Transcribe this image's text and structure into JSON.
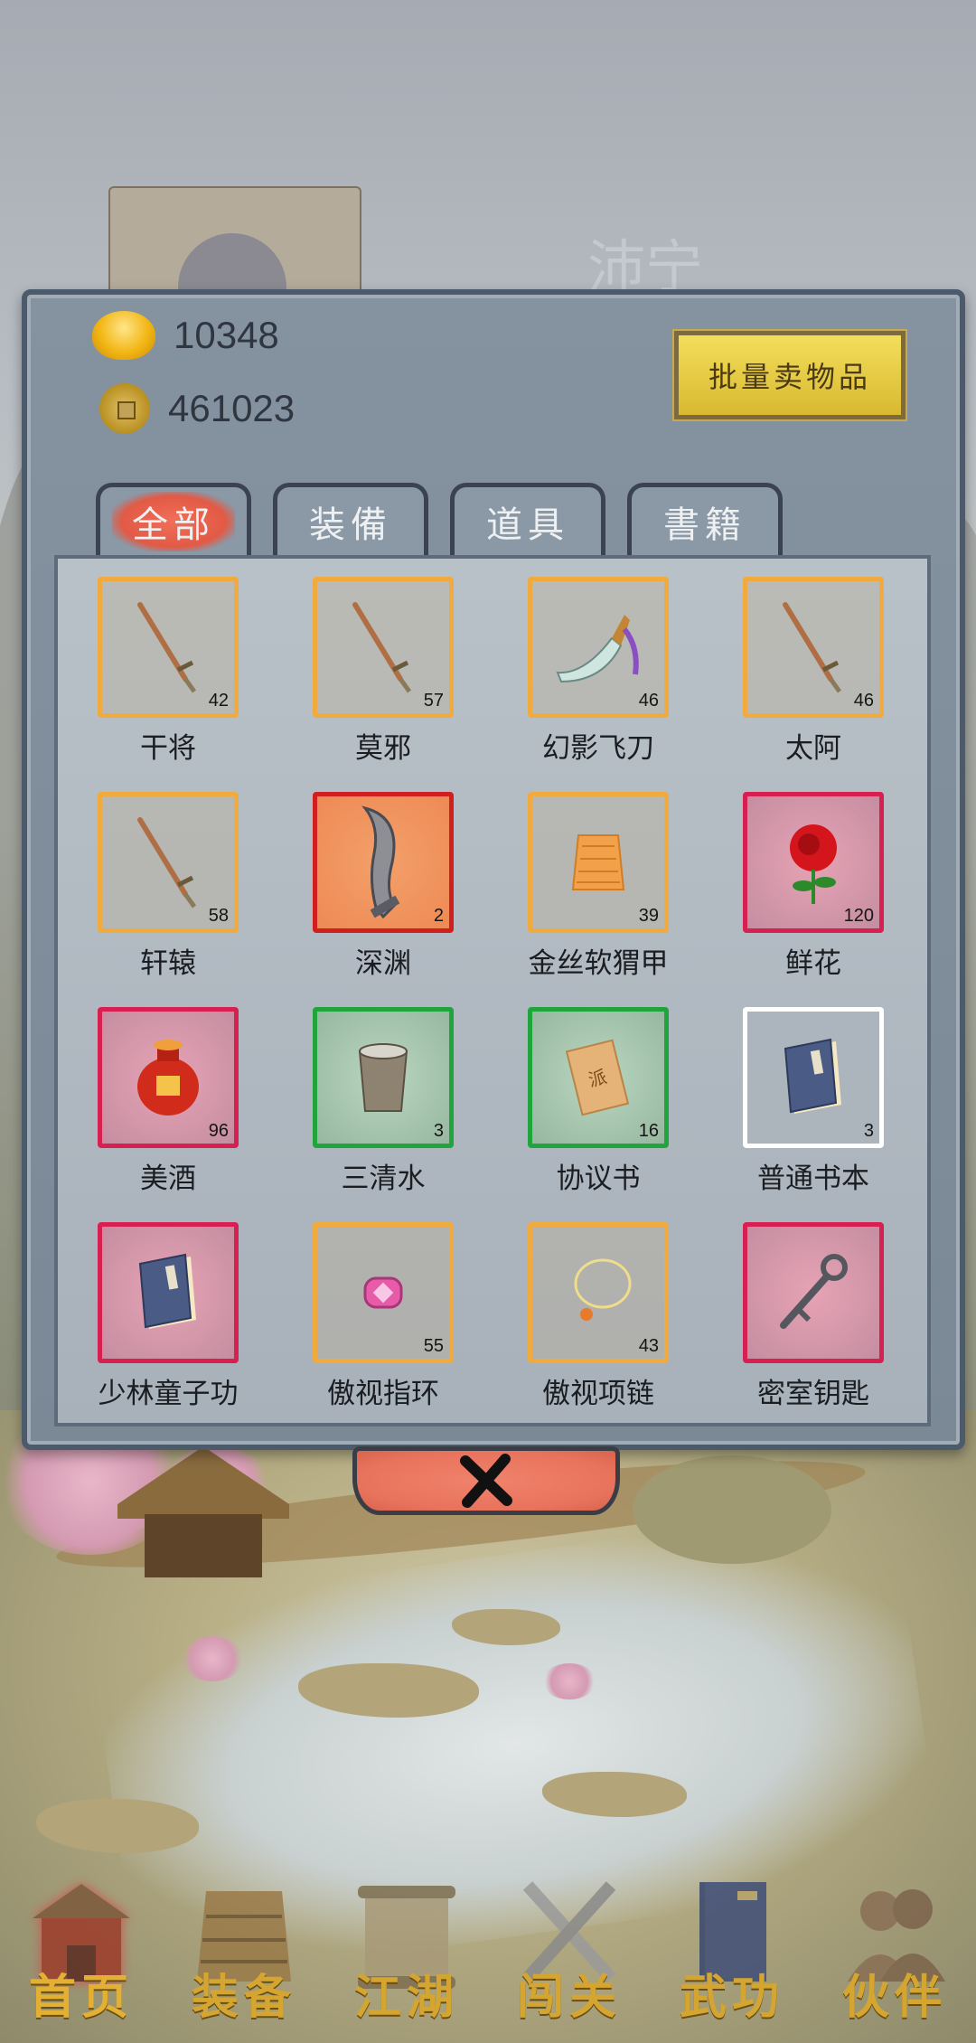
{
  "background": {
    "location_title": "沛宁"
  },
  "currency": {
    "gold": "10348",
    "coins": "461023"
  },
  "batch_sell_label": "批量卖物品",
  "tabs": [
    {
      "label": "全部",
      "active": true
    },
    {
      "label": "装備",
      "active": false
    },
    {
      "label": "道具",
      "active": false
    },
    {
      "label": "書籍",
      "active": false
    }
  ],
  "items": [
    {
      "name": "干将",
      "count": "42",
      "quality": "orange",
      "icon": "sword-icon"
    },
    {
      "name": "莫邪",
      "count": "57",
      "quality": "orange",
      "icon": "sword-icon"
    },
    {
      "name": "幻影飞刀",
      "count": "46",
      "quality": "orange",
      "icon": "flying-knife-icon"
    },
    {
      "name": "太阿",
      "count": "46",
      "quality": "orange",
      "icon": "sword-icon"
    },
    {
      "name": "轩辕",
      "count": "58",
      "quality": "orange",
      "icon": "sword-icon"
    },
    {
      "name": "深渊",
      "count": "2",
      "quality": "special",
      "icon": "abyss-blade-icon"
    },
    {
      "name": "金丝软猬甲",
      "count": "39",
      "quality": "orange",
      "icon": "armor-icon"
    },
    {
      "name": "鲜花",
      "count": "120",
      "quality": "red",
      "icon": "rose-icon"
    },
    {
      "name": "美酒",
      "count": "96",
      "quality": "red",
      "icon": "wine-jar-icon"
    },
    {
      "name": "三清水",
      "count": "3",
      "quality": "green",
      "icon": "bucket-icon"
    },
    {
      "name": "协议书",
      "count": "16",
      "quality": "green",
      "icon": "scroll-icon"
    },
    {
      "name": "普通书本",
      "count": "3",
      "quality": "white",
      "icon": "book-icon"
    },
    {
      "name": "少林童子功",
      "count": "",
      "quality": "red",
      "icon": "book-icon"
    },
    {
      "name": "傲视指环",
      "count": "55",
      "quality": "orange",
      "icon": "ring-icon"
    },
    {
      "name": "傲视项链",
      "count": "43",
      "quality": "orange",
      "icon": "necklace-icon"
    },
    {
      "name": "密室钥匙",
      "count": "",
      "quality": "red",
      "icon": "key-icon"
    }
  ],
  "quality_colors": {
    "orange": "#f0aa3e",
    "red": "#d81f52",
    "green": "#1fa53c",
    "white": "#ffffff",
    "special": "#d11f1f"
  },
  "nav": [
    {
      "label": "首页",
      "icon": "house-icon",
      "active": true
    },
    {
      "label": "装备",
      "icon": "armor-icon"
    },
    {
      "label": "江湖",
      "icon": "scroll-icon"
    },
    {
      "label": "闯关",
      "icon": "crossed-swords-icon"
    },
    {
      "label": "武功",
      "icon": "book-icon"
    },
    {
      "label": "伙伴",
      "icon": "partners-icon"
    }
  ]
}
